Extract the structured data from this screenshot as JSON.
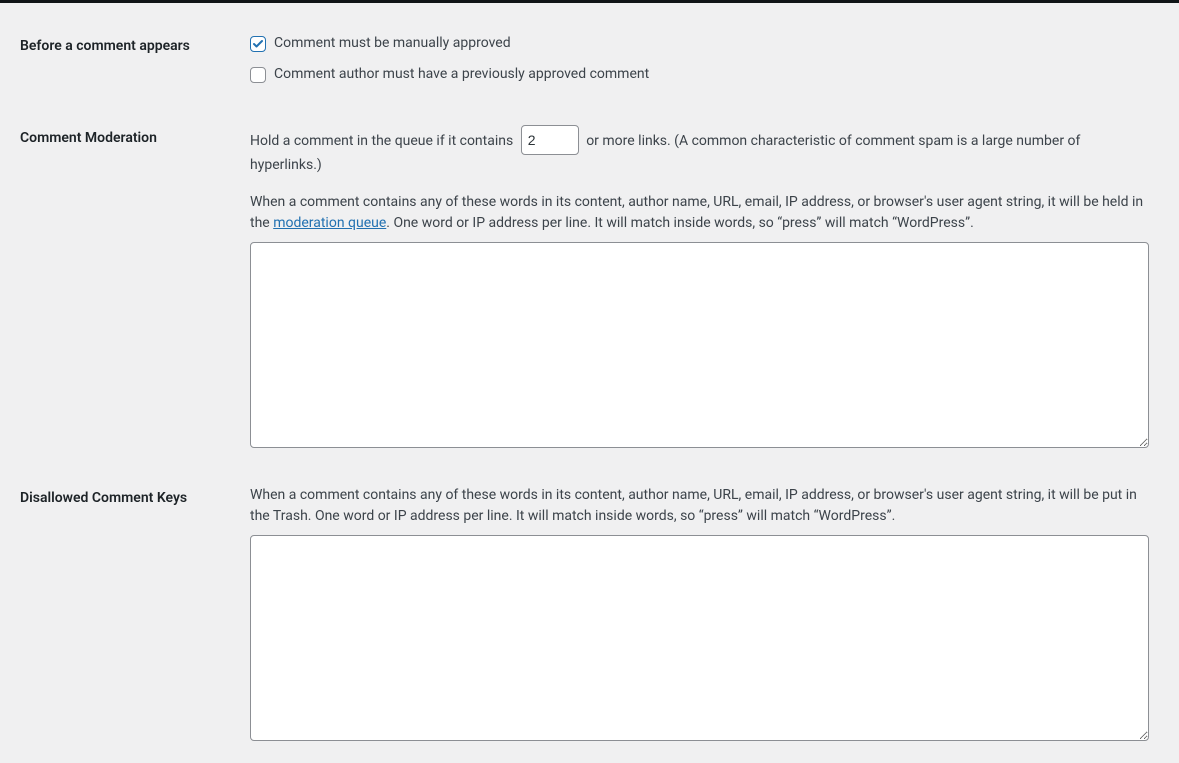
{
  "before_appears": {
    "heading": "Before a comment appears",
    "option_manual": "Comment must be manually approved",
    "manual_checked": true,
    "option_prev": "Comment author must have a previously approved comment",
    "prev_checked": false
  },
  "moderation": {
    "heading": "Comment Moderation",
    "hold_pre": "Hold a comment in the queue if it contains",
    "links_value": "2",
    "hold_post": "or more links. (A common characteristic of comment spam is a large number of hyperlinks.)",
    "help_pre": "When a comment contains any of these words in its content, author name, URL, email, IP address, or browser's user agent string, it will be held in the ",
    "queue_link": "moderation queue",
    "help_post": ". One word or IP address per line. It will match inside words, so “press” will match “WordPress”.",
    "textarea_value": ""
  },
  "disallowed": {
    "heading": "Disallowed Comment Keys",
    "help": "When a comment contains any of these words in its content, author name, URL, email, IP address, or browser's user agent string, it will be put in the Trash. One word or IP address per line. It will match inside words, so “press” will match “WordPress”.",
    "textarea_value": ""
  }
}
